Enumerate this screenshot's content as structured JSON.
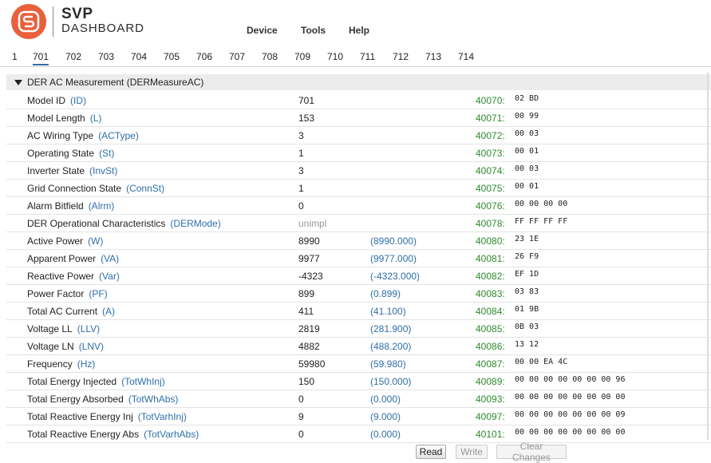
{
  "brand": {
    "name_top": "SVP",
    "name_bottom": "DASHBOARD",
    "logo_color": "#e8603c"
  },
  "menu": [
    {
      "label": "Device"
    },
    {
      "label": "Tools"
    },
    {
      "label": "Help"
    }
  ],
  "tabs": [
    "1",
    "701",
    "702",
    "703",
    "704",
    "705",
    "706",
    "707",
    "708",
    "709",
    "710",
    "711",
    "712",
    "713",
    "714"
  ],
  "active_tab": "701",
  "section": {
    "title": "DER AC Measurement (DERMeasureAC)",
    "icon": "collapse-triangle-icon"
  },
  "rows": [
    {
      "label": "Model ID",
      "abbr": "(ID)",
      "value": "701",
      "scaled": "",
      "addr": "40070:",
      "hex": "02 BD"
    },
    {
      "label": "Model Length",
      "abbr": "(L)",
      "value": "153",
      "scaled": "",
      "addr": "40071:",
      "hex": "00 99"
    },
    {
      "label": "AC Wiring Type",
      "abbr": "(ACType)",
      "value": "3",
      "scaled": "",
      "addr": "40072:",
      "hex": "00 03"
    },
    {
      "label": "Operating State",
      "abbr": "(St)",
      "value": "1",
      "scaled": "",
      "addr": "40073:",
      "hex": "00 01"
    },
    {
      "label": "Inverter State",
      "abbr": "(InvSt)",
      "value": "3",
      "scaled": "",
      "addr": "40074:",
      "hex": "00 03"
    },
    {
      "label": "Grid Connection State",
      "abbr": "(ConnSt)",
      "value": "1",
      "scaled": "",
      "addr": "40075:",
      "hex": "00 01"
    },
    {
      "label": "Alarm Bitfield",
      "abbr": "(Alrm)",
      "value": "0",
      "scaled": "",
      "addr": "40076:",
      "hex": "00 00 00 00"
    },
    {
      "label": "DER Operational Characteristics",
      "abbr": "(DERMode)",
      "value": "unimpl",
      "scaled": "",
      "addr": "40078:",
      "hex": "FF FF FF FF",
      "unimpl": true
    },
    {
      "label": "Active Power",
      "abbr": "(W)",
      "value": "8990",
      "scaled": "(8990.000)",
      "addr": "40080:",
      "hex": "23 1E"
    },
    {
      "label": "Apparent Power",
      "abbr": "(VA)",
      "value": "9977",
      "scaled": "(9977.000)",
      "addr": "40081:",
      "hex": "26 F9"
    },
    {
      "label": "Reactive Power",
      "abbr": "(Var)",
      "value": "-4323",
      "scaled": "(-4323.000)",
      "addr": "40082:",
      "hex": "EF 1D"
    },
    {
      "label": "Power Factor",
      "abbr": "(PF)",
      "value": "899",
      "scaled": "(0.899)",
      "addr": "40083:",
      "hex": "03 83"
    },
    {
      "label": "Total AC Current",
      "abbr": "(A)",
      "value": "411",
      "scaled": "(41.100)",
      "addr": "40084:",
      "hex": "01 9B"
    },
    {
      "label": "Voltage LL",
      "abbr": "(LLV)",
      "value": "2819",
      "scaled": "(281.900)",
      "addr": "40085:",
      "hex": "0B 03"
    },
    {
      "label": "Voltage LN",
      "abbr": "(LNV)",
      "value": "4882",
      "scaled": "(488.200)",
      "addr": "40086:",
      "hex": "13 12"
    },
    {
      "label": "Frequency",
      "abbr": "(Hz)",
      "value": "59980",
      "scaled": "(59.980)",
      "addr": "40087:",
      "hex": "00 00 EA 4C"
    },
    {
      "label": "Total Energy Injected",
      "abbr": "(TotWhInj)",
      "value": "150",
      "scaled": "(150.000)",
      "addr": "40089:",
      "hex": "00 00 00 00 00 00 00 96"
    },
    {
      "label": "Total Energy Absorbed",
      "abbr": "(TotWhAbs)",
      "value": "0",
      "scaled": "(0.000)",
      "addr": "40093:",
      "hex": "00 00 00 00 00 00 00 00"
    },
    {
      "label": "Total Reactive Energy Inj",
      "abbr": "(TotVarhInj)",
      "value": "9",
      "scaled": "(9.000)",
      "addr": "40097:",
      "hex": "00 00 00 00 00 00 00 09"
    },
    {
      "label": "Total Reactive Energy Abs",
      "abbr": "(TotVarhAbs)",
      "value": "0",
      "scaled": "(0.000)",
      "addr": "40101:",
      "hex": "00 00 00 00 00 00 00 00"
    }
  ],
  "buttons": {
    "read": "Read",
    "write": "Write",
    "clear": "Clear Changes"
  }
}
